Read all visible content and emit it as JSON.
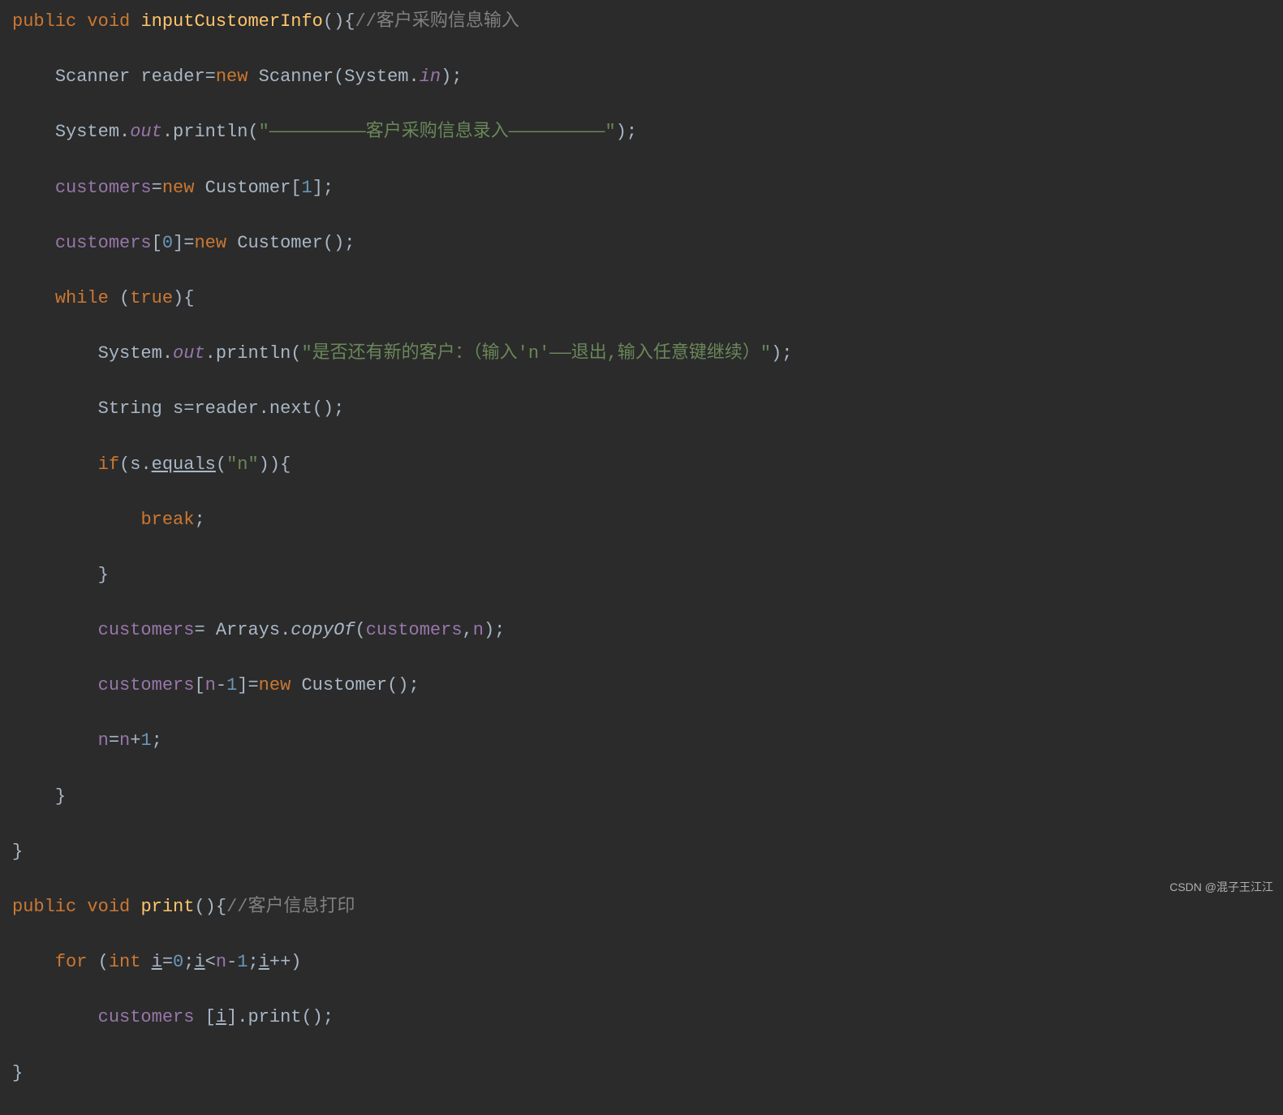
{
  "tokens": {
    "public": "public",
    "void": "void",
    "new": "new",
    "while": "while",
    "true": "true",
    "if": "if",
    "break": "break",
    "for": "for",
    "int": "int"
  },
  "method1": {
    "name": "inputCustomerInfo",
    "comment": "//客户采购信息输入"
  },
  "line2": {
    "scanner_type": "Scanner",
    "reader_var": "reader",
    "scanner_ctor": "Scanner",
    "system": "System",
    "in": "in"
  },
  "line3": {
    "system": "System",
    "out": "out",
    "println": "println",
    "str": "\"—————————客户采购信息录入—————————\""
  },
  "line4": {
    "customers": "customers",
    "customer_type": "Customer",
    "one": "1"
  },
  "line5": {
    "customers": "customers",
    "zero": "0",
    "customer_type": "Customer"
  },
  "line7": {
    "system": "System",
    "out": "out",
    "println": "println",
    "str": "\"是否还有新的客户：（输入'n'——退出,输入任意键继续）\""
  },
  "line8": {
    "string_type": "String",
    "s": "s",
    "reader": "reader",
    "next": "next"
  },
  "line9": {
    "s": "s",
    "equals": "equals",
    "n_str": "\"n\""
  },
  "line12": {
    "customers": "customers",
    "arrays": "Arrays",
    "copyof": "copyOf",
    "n": "n"
  },
  "line13": {
    "customers": "customers",
    "n": "n",
    "one": "1",
    "customer_type": "Customer"
  },
  "line14": {
    "n": "n",
    "one": "1"
  },
  "method2": {
    "name": "print",
    "comment": "//客户信息打印"
  },
  "line_for": {
    "i": "i",
    "zero": "0",
    "n": "n",
    "one": "1"
  },
  "line_print": {
    "customers": "customers",
    "i": "i",
    "print": "print"
  },
  "watermark": "CSDN @混子王江江"
}
